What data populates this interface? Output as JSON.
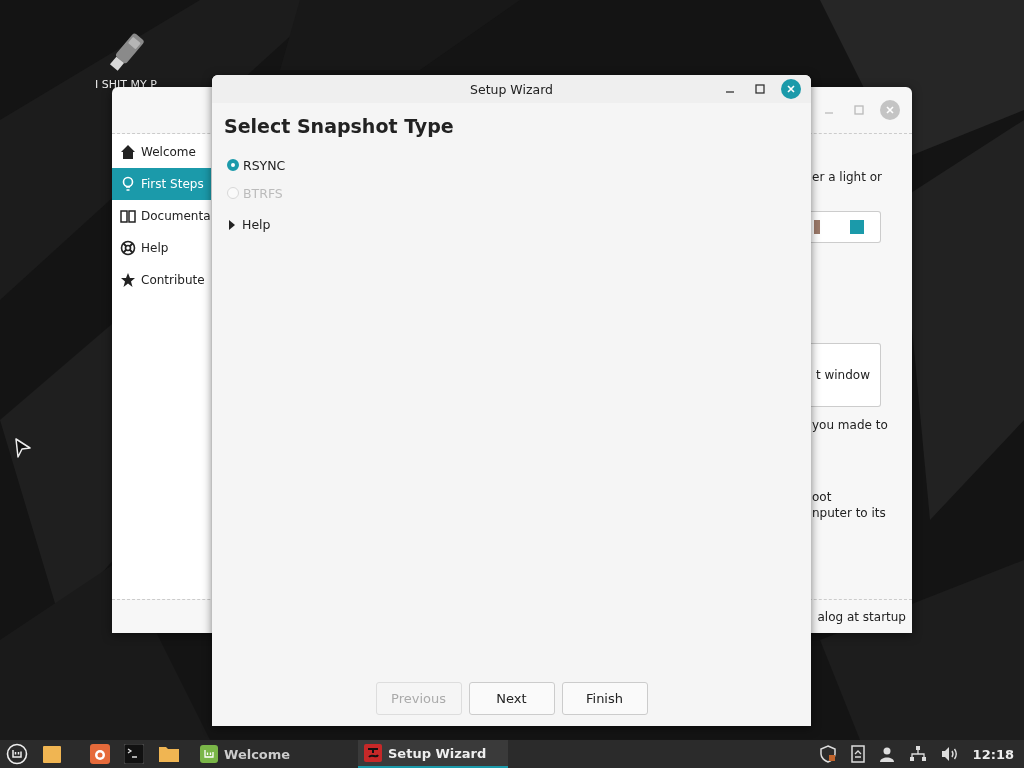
{
  "desktop": {
    "icon_label": "I SHIT MY P"
  },
  "welcome_window": {
    "sidebar": {
      "items": [
        {
          "label": "Welcome",
          "selected": false
        },
        {
          "label": "First Steps",
          "selected": true
        },
        {
          "label": "Documenta",
          "selected": false
        },
        {
          "label": "Help",
          "selected": false
        },
        {
          "label": "Contribute",
          "selected": false
        }
      ]
    },
    "fragments": [
      "er a light or",
      "t window",
      "you made to",
      "oot",
      "nputer to its"
    ],
    "footer": "alog at startup"
  },
  "wizard": {
    "title": "Setup Wizard",
    "heading": "Select Snapshot Type",
    "options": [
      {
        "label": "RSYNC",
        "selected": true,
        "disabled": false
      },
      {
        "label": "BTRFS",
        "selected": false,
        "disabled": true
      }
    ],
    "expander": {
      "label": "Help",
      "expanded": false
    },
    "buttons": [
      {
        "label": "Previous",
        "disabled": true
      },
      {
        "label": "Next",
        "disabled": false
      },
      {
        "label": "Finish",
        "disabled": false
      }
    ]
  },
  "taskbar": {
    "windows": [
      {
        "label": "Welcome",
        "active": false
      },
      {
        "label": "Setup Wizard",
        "active": true
      }
    ],
    "clock": "12:18"
  }
}
